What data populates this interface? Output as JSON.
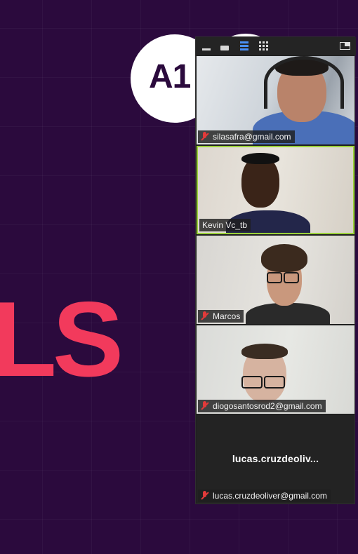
{
  "slide": {
    "badge_text": "A1",
    "big_text": "LS"
  },
  "colors": {
    "background": "#2b0a3d",
    "accent": "#f23a5c",
    "active_speaker_border": "#9bd13a",
    "muted_mic": "#e23a3a"
  },
  "toolbar": {
    "icons": [
      "minimize-icon",
      "single-view-icon",
      "strip-view-icon",
      "gallery-view-icon",
      "picture-in-picture-icon"
    ]
  },
  "participants": [
    {
      "name": "silasafra@gmail.com",
      "muted": true,
      "active": false,
      "video": true
    },
    {
      "name": "Kevin Vc_tb",
      "muted": false,
      "active": true,
      "video": true
    },
    {
      "name": "Marcos",
      "muted": true,
      "active": false,
      "video": true
    },
    {
      "name": "diogosantosrod2@gmail.com",
      "muted": true,
      "active": false,
      "video": true
    },
    {
      "name": "lucas.cruzdeoliver@gmail.com",
      "display_name": "lucas.cruzdeoliv...",
      "muted": true,
      "active": false,
      "video": false
    }
  ]
}
